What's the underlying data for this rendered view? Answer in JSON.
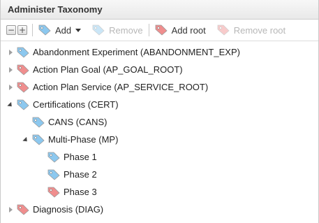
{
  "panel": {
    "title": "Administer Taxonomy"
  },
  "toolbar": {
    "collapse_glyph": "−",
    "expand_glyph": "+",
    "add_label": "Add",
    "remove_label": "Remove",
    "add_root_label": "Add root",
    "remove_root_label": "Remove root"
  },
  "colors": {
    "tag_blue": "#8cc8ef",
    "tag_red": "#f08e8e",
    "tag_border": "#9a9a9a"
  },
  "tree": [
    {
      "label": "Abandonment Experiment (ABANDONMENT_EXP)",
      "state": "collapsed",
      "tag": "blue"
    },
    {
      "label": "Action Plan Goal (AP_GOAL_ROOT)",
      "state": "collapsed",
      "tag": "red"
    },
    {
      "label": "Action Plan Service (AP_SERVICE_ROOT)",
      "state": "collapsed",
      "tag": "red"
    },
    {
      "label": "Certifications (CERT)",
      "state": "expanded",
      "tag": "blue"
    },
    {
      "label": "CANS (CANS)",
      "state": "leaf",
      "tag": "blue"
    },
    {
      "label": "Multi-Phase (MP)",
      "state": "expanded",
      "tag": "blue"
    },
    {
      "label": "Phase 1",
      "state": "leaf",
      "tag": "blue"
    },
    {
      "label": "Phase 2",
      "state": "leaf",
      "tag": "blue"
    },
    {
      "label": "Phase 3",
      "state": "leaf",
      "tag": "red"
    },
    {
      "label": "Diagnosis (DIAG)",
      "state": "collapsed",
      "tag": "red"
    }
  ]
}
